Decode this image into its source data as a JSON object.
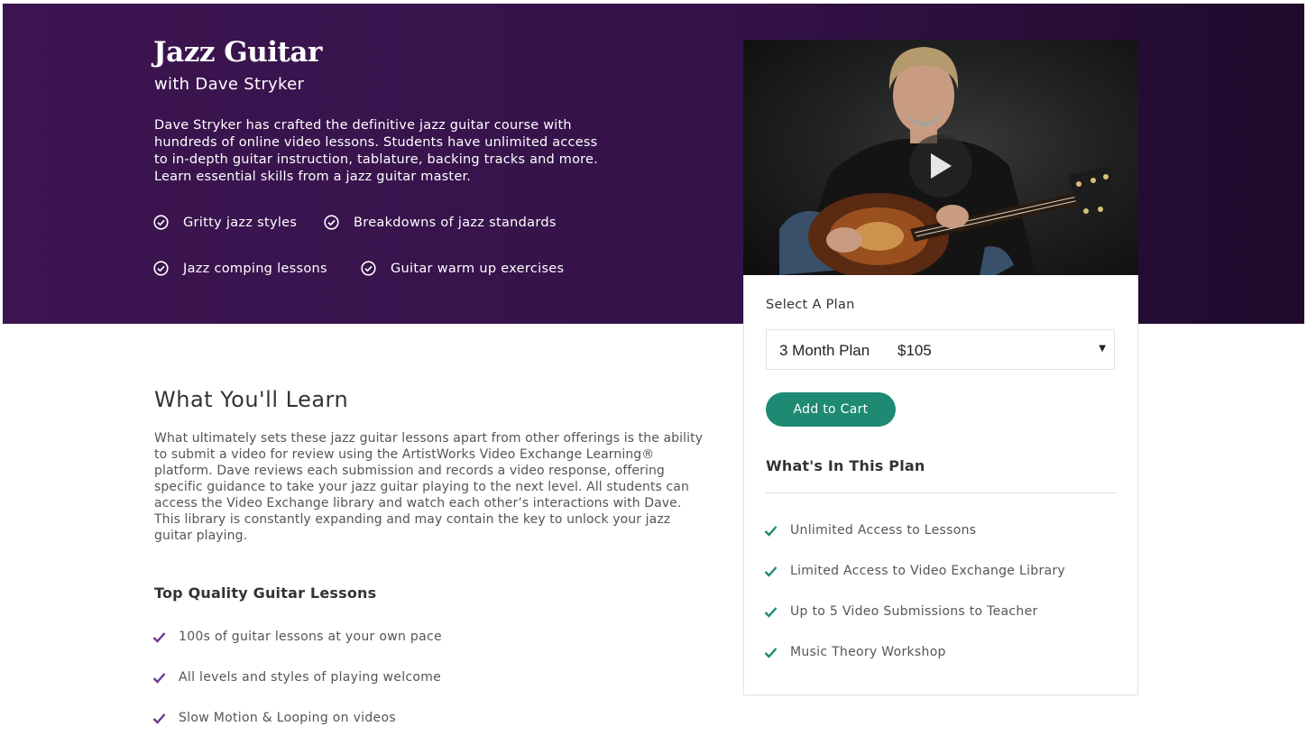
{
  "hero": {
    "title": "Jazz Guitar",
    "subtitle": "with Dave Stryker",
    "description": "Dave Stryker has crafted the definitive jazz guitar course with hundreds of online video lessons. Students have unlimited access to in-depth guitar instruction, tablature, backing tracks and more. Learn essential skills from a jazz guitar master.",
    "features": [
      "Gritty jazz styles",
      "Breakdowns of jazz standards",
      "Jazz comping lessons",
      "Guitar warm up exercises"
    ],
    "background_color": "#35124a"
  },
  "video": {
    "play_icon": "play-icon"
  },
  "plan_card": {
    "select_label": "Select A Plan",
    "selected_plan": {
      "name": "3 Month Plan",
      "price": "$105"
    },
    "add_to_cart_label": "Add to Cart",
    "button_color": "#1e8a73",
    "heading": "What's In This Plan",
    "items": [
      "Unlimited Access to Lessons",
      "Limited Access to Video Exchange Library",
      "Up to 5 Video Submissions to Teacher",
      "Music Theory Workshop"
    ],
    "check_color": "#1e8a73"
  },
  "learn": {
    "title": "What You'll Learn",
    "description": "What ultimately sets these jazz guitar lessons apart from other offerings is the ability to submit a video for review using the ArtistWorks Video Exchange Learning® platform. Dave reviews each submission and records a video response, offering specific guidance to take your jazz guitar playing to the next level. All students can access the Video Exchange library and watch each other’s interactions with Dave. This library is constantly expanding and may contain the key to unlock your jazz guitar playing.",
    "subheading": "Top Quality Guitar Lessons",
    "items": [
      "100s of guitar lessons at your own pace",
      "All levels and styles of playing welcome",
      "Slow Motion & Looping on videos"
    ],
    "check_color": "#6b3a8a"
  }
}
